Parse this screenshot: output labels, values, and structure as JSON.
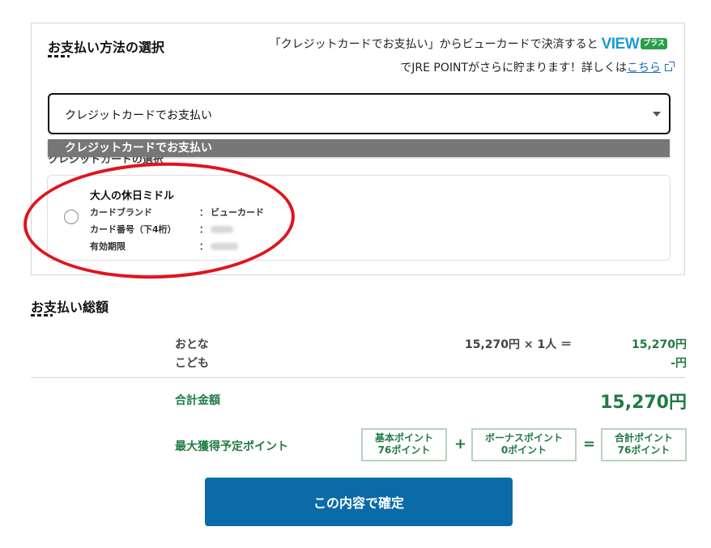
{
  "payment_method": {
    "title": "お支払い方法の選択",
    "promo_line1": "「クレジットカードでお支払い」からビューカードで決済すると",
    "view_logo_text": "VIEW",
    "view_logo_badge": "プラス",
    "promo_line2_prefix": "でJRE POINTがさらに貯まります！詳しくは",
    "promo_link": "こちら",
    "selected_value": "クレジットカードでお支払い",
    "dropdown_option": "クレジットカードでお支払い",
    "card_section_label": "クレジットカードの選択",
    "card": {
      "name": "大人の休日ミドル",
      "brand_label": "カードブランド",
      "brand_value": "ビューカード",
      "number_label": "カード番号（下4桁）",
      "expiry_label": "有効期限",
      "separator": "："
    }
  },
  "total": {
    "title": "お支払い総額",
    "adult_label": "おとな",
    "adult_calc": "15,270円 × 1人 ＝",
    "adult_amount": "15,270円",
    "child_label": "こども",
    "child_amount": "-円",
    "sum_label": "合計金額",
    "sum_value": "15,270円",
    "points_label": "最大獲得予定ポイント",
    "basic_points_title": "基本ポイント",
    "basic_points_value": "76ポイント",
    "bonus_points_title": "ボーナスポイント",
    "bonus_points_value": "0ポイント",
    "total_points_title": "合計ポイント",
    "total_points_value": "76ポイント",
    "plus": "+",
    "equals": "="
  },
  "confirm_button": "この内容で確定",
  "colors": {
    "accent_green": "#217a43",
    "button_blue": "#0b6aa8",
    "annotation_red": "#e0141e",
    "link_blue": "#1a6dbf"
  }
}
